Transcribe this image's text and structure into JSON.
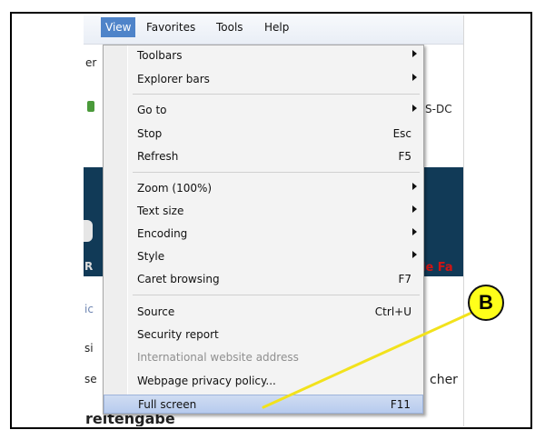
{
  "menubar": {
    "items": [
      {
        "label": "View",
        "active": true
      },
      {
        "label": "Favorites"
      },
      {
        "label": "Tools"
      },
      {
        "label": "Help"
      }
    ]
  },
  "background": {
    "left_fragments": [
      "er",
      "R",
      "ic",
      "si",
      "se"
    ],
    "right_fragments": [
      "S-DC",
      "le Fa",
      "cher"
    ],
    "bottom_fragment": "reitengabe"
  },
  "view_menu": {
    "items": [
      {
        "label": "Toolbars",
        "shortcut": "",
        "submenu": true
      },
      {
        "label": "Explorer bars",
        "shortcut": "",
        "submenu": true
      },
      {
        "label": "Go to",
        "shortcut": "",
        "submenu": true
      },
      {
        "label": "Stop",
        "shortcut": "Esc",
        "submenu": false
      },
      {
        "label": "Refresh",
        "shortcut": "F5",
        "submenu": false
      },
      {
        "label": "Zoom (100%)",
        "shortcut": "",
        "submenu": true
      },
      {
        "label": "Text size",
        "shortcut": "",
        "submenu": true
      },
      {
        "label": "Encoding",
        "shortcut": "",
        "submenu": true
      },
      {
        "label": "Style",
        "shortcut": "",
        "submenu": true
      },
      {
        "label": "Caret browsing",
        "shortcut": "F7",
        "submenu": false
      },
      {
        "label": "Source",
        "shortcut": "Ctrl+U",
        "submenu": false
      },
      {
        "label": "Security report",
        "shortcut": "",
        "submenu": false
      },
      {
        "label": "International website address",
        "shortcut": "",
        "submenu": false,
        "disabled": true
      },
      {
        "label": "Webpage privacy policy...",
        "shortcut": "",
        "submenu": false
      },
      {
        "label": "Full screen",
        "shortcut": "F11",
        "submenu": false,
        "highlighted": true
      }
    ]
  },
  "callout": {
    "label": "B"
  },
  "colors": {
    "callout_fill": "#ffff1a",
    "menu_highlight": "#b7cbee",
    "view_active": "#4f84c9",
    "dark_band": "#113a57"
  }
}
